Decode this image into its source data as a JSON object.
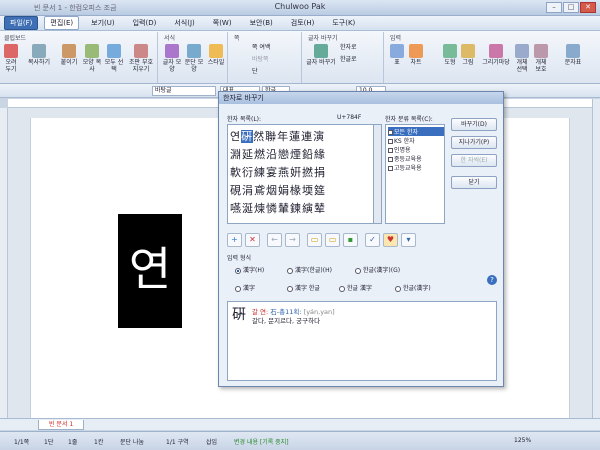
{
  "window": {
    "doc_title": "빈 문서 1 - 한컴오피스 조금",
    "app_user": "Chulwoo Pak"
  },
  "menus": [
    "파일(F)",
    "편집(E)",
    "보기(U)",
    "입력(D)",
    "서식(J)",
    "쪽(W)",
    "보안(B)",
    "검토(H)",
    "도구(K)"
  ],
  "ribbon": {
    "groups": [
      "클립보드",
      "서식",
      "쪽",
      "글자 바꾸기",
      "입력"
    ],
    "buttons": [
      "오려 두기",
      "복사하기",
      "붙이기",
      "모양 복사",
      "모두 선택",
      "조판 부호 지우기",
      "글자 모양",
      "문단 모양",
      "스타일",
      "쪽 여백",
      "바탕쪽",
      "단",
      "한자로",
      "한글로",
      "글자 바꾸기",
      "표",
      "차트",
      "도형",
      "그림",
      "그리기마당",
      "개체 선택",
      "개체 보호",
      "문자표"
    ]
  },
  "format_bar": {
    "style": "바탕글",
    "font": "대표",
    "lang": "한글",
    "size": "10.0"
  },
  "document": {
    "big_char": "연",
    "tab_label": "빈 문서 1"
  },
  "status": {
    "page": "1/1쪽",
    "col": "1단",
    "line": "1줄",
    "chars": "1칸",
    "line_num": "문단 나눔",
    "section": "1/1 구역",
    "mode": "삽입",
    "track": "변경 내용 [기록 중지]",
    "zoom": "125%"
  },
  "dialog": {
    "title": "한자로 바꾸기",
    "list_label": "한자 목록(L):",
    "code": "U+784F",
    "cat_label": "한자 분류 목록(C):",
    "hanja_rows": [
      [
        "연",
        "硏",
        "然",
        "聯",
        "年",
        "蓮",
        "連",
        "演"
      ],
      [
        "淵",
        "延",
        "燃",
        "沿",
        "戀",
        "煙",
        "鉛",
        "緣"
      ],
      [
        "軟",
        "衍",
        "練",
        "宴",
        "燕",
        "姸",
        "撚",
        "捐"
      ],
      [
        "硯",
        "涓",
        "鳶",
        "烟",
        "娟",
        "椽",
        "堧",
        "筵"
      ],
      [
        "嚥",
        "涎",
        "煉",
        "憐",
        "輦",
        "鍊",
        "縯",
        "辇"
      ]
    ],
    "categories": [
      "모든 한자",
      "KS 한자",
      "인명용",
      "중등교육용",
      "고등교육용"
    ],
    "buttons": [
      "바꾸기(D)",
      "지나가기(P)",
      "한 자씩(E)",
      "닫기"
    ],
    "format_label": "입력 형식",
    "radios": [
      "漢字(H)",
      "漢字(한글)(H)",
      "한글(漢字)(G)",
      "漢字",
      "漢字 한글",
      "한글 漢字",
      "한글(漢字)"
    ],
    "meaning": {
      "hanja": "硏",
      "line1_prefix": "갈 연:",
      "line1_detail": "石-총11획:",
      "line1_pron": "[yán,yan]",
      "line2": "갈다, 문지르다, 궁구하다"
    }
  }
}
